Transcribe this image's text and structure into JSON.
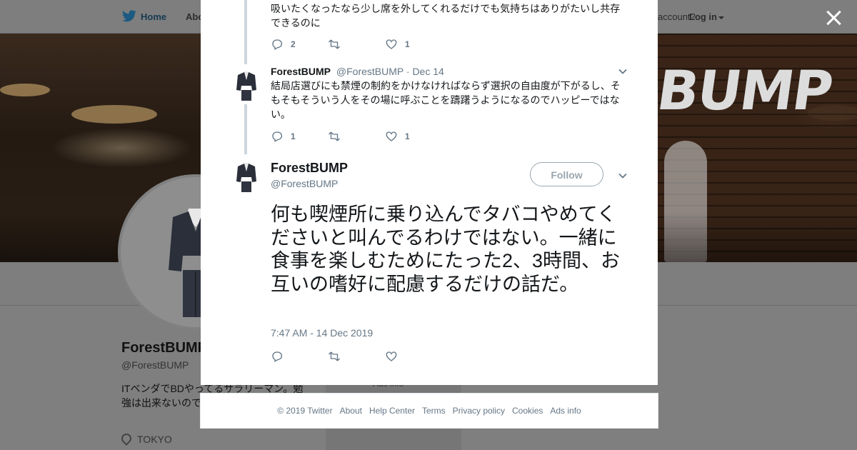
{
  "topnav": {
    "home_label": "Home",
    "about_label": "About",
    "account_label": "account?",
    "login_label": "Log in"
  },
  "banner": {
    "brand_text": "BUMP"
  },
  "profile": {
    "name": "ForestBUMP",
    "handle": "@ForestBUMP",
    "bio": "ITベンダでBDやってるサラリーマン。勉強は出来ないので論は分からない。",
    "location": "TOKYO",
    "ads_info": "Ads info"
  },
  "thread": {
    "reply1": {
      "text": "吸いたくなったなら少し席を外してくれるだけでも気持ちはありがたいし共存できるのに",
      "reply_count": "2",
      "retweet_count": "",
      "like_count": "1"
    },
    "reply2": {
      "name": "ForestBUMP",
      "handle": "@ForestBUMP",
      "date": "· Dec 14",
      "text": "結局店選びにも禁煙の制約をかけなければならず選択の自由度が下がるし、そもそもそういう人をその場に呼ぶことを躊躇うようになるのでハッピーではない。",
      "reply_count": "1",
      "retweet_count": "",
      "like_count": "1"
    }
  },
  "main_tweet": {
    "name": "ForestBUMP",
    "handle": "@ForestBUMP",
    "follow_label": "Follow",
    "text": "何も喫煙所に乗り込んでタバコやめてくださいと叫んでるわけではない。一緒に食事を楽しむためにたった2、3時間、お互いの嗜好に配慮するだけの話だ。",
    "timestamp": "7:47 AM - 14 Dec 2019"
  },
  "footer": {
    "copyright": "© 2019 Twitter",
    "links": [
      "About",
      "Help Center",
      "Terms",
      "Privacy policy",
      "Cookies",
      "Ads info"
    ]
  },
  "colors": {
    "twitter_blue": "#1da1f2",
    "text_primary": "#14171a",
    "text_secondary": "#657786",
    "thread_line": "#ccd6dd",
    "overlay_dim": "#7f7f7f"
  },
  "icons": [
    "twitter-bird-icon",
    "close-icon",
    "reply-icon",
    "retweet-icon",
    "like-icon",
    "chevron-down-icon",
    "location-pin-icon"
  ]
}
